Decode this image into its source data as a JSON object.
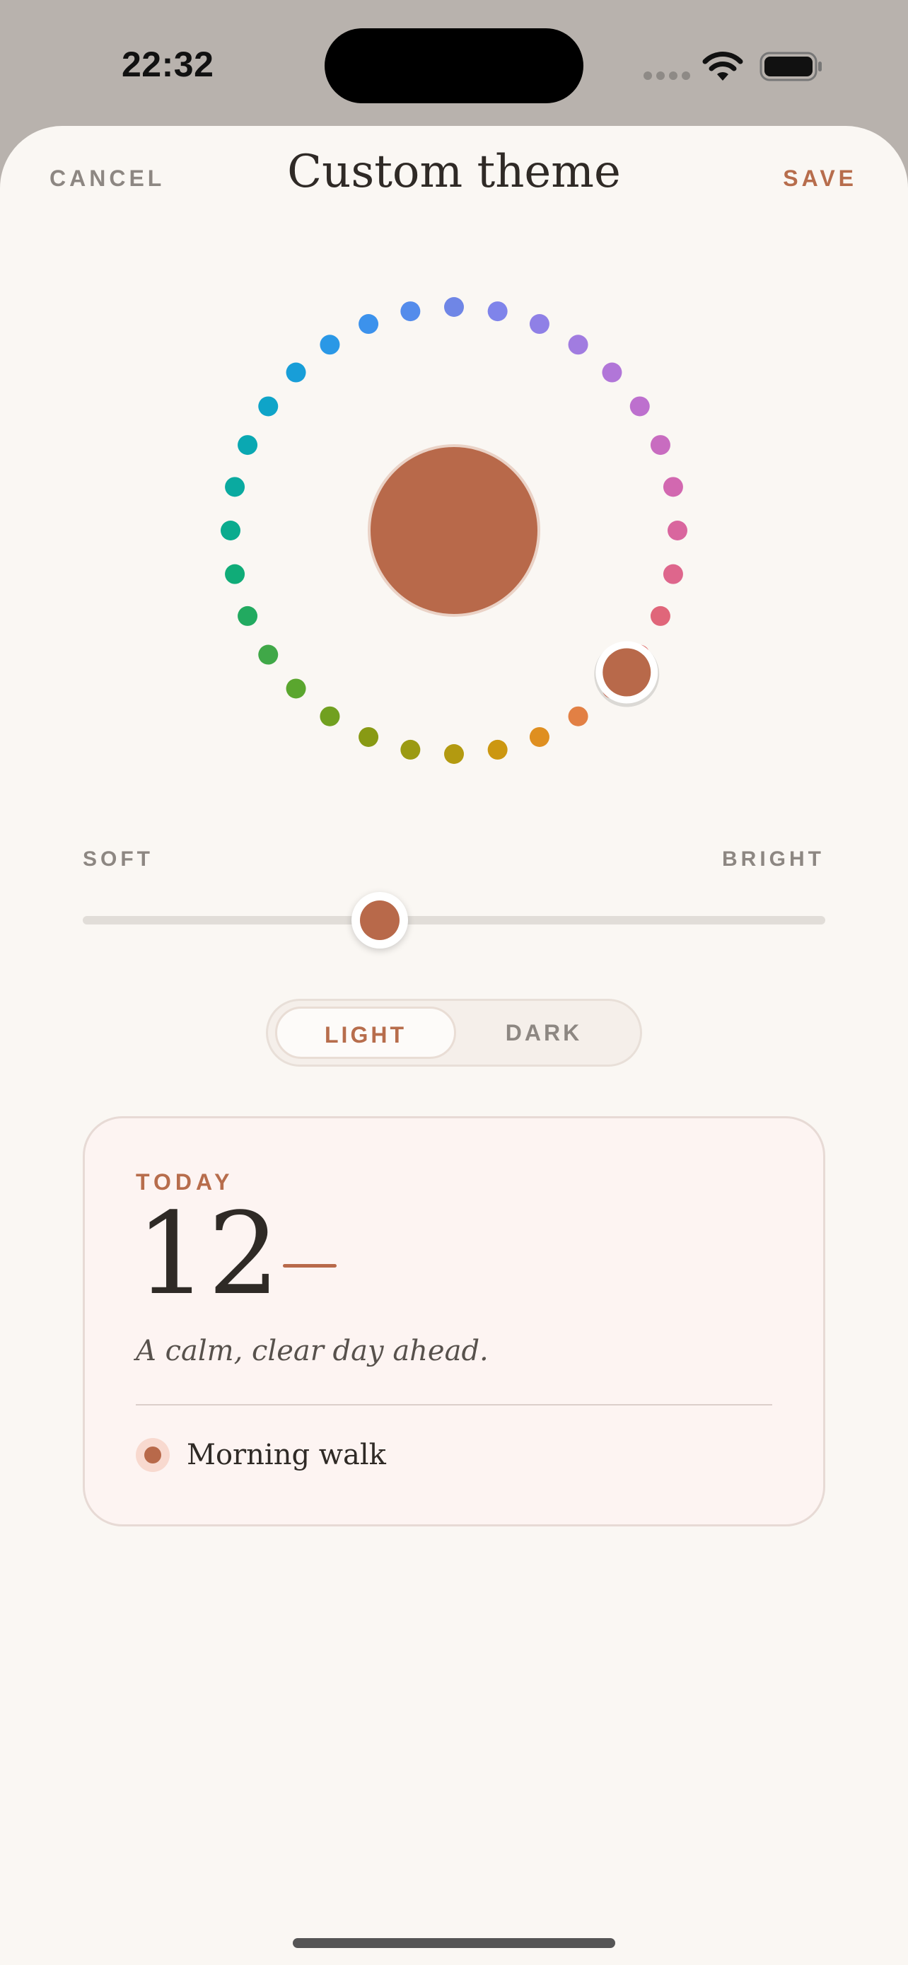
{
  "status_bar": {
    "time": "22:32",
    "icons": [
      "signal-icon",
      "wifi-icon",
      "battery-icon"
    ]
  },
  "nav": {
    "cancel_label": "CANCEL",
    "title": "Custom theme",
    "save_label": "SAVE"
  },
  "color_wheel": {
    "selected_color": "#b8694a",
    "hue_dots": [
      "#6f86e6",
      "#7f84ea",
      "#8f80e6",
      "#a17ce0",
      "#b176d8",
      "#bd70ce",
      "#c86cc0",
      "#d268b0",
      "#d9669e",
      "#de668c",
      "#e0667a",
      "#de6a66",
      "#e27358",
      "#e28044",
      "#df8f20",
      "#cc9710",
      "#b39a10",
      "#9b9a12",
      "#889a14",
      "#71a020",
      "#5aa62e",
      "#40a848",
      "#22aa60",
      "#10ac78",
      "#0aab8e",
      "#0aaaa0",
      "#0aa8b2",
      "#0fa4c8",
      "#189ed8",
      "#2a98e6",
      "#3c92ec",
      "#548ceb"
    ]
  },
  "brightness": {
    "soft_label": "SOFT",
    "bright_label": "BRIGHT",
    "value": 0.4
  },
  "mode": {
    "options": [
      "LIGHT",
      "DARK"
    ],
    "selected": "LIGHT"
  },
  "preview": {
    "today_label": "TODAY",
    "day": "12",
    "caption": "A calm, clear day ahead.",
    "event_label": "Morning walk"
  },
  "colors": {
    "accent": "#b76d4c",
    "background": "#faf7f3",
    "card": "#fdf4f2"
  }
}
